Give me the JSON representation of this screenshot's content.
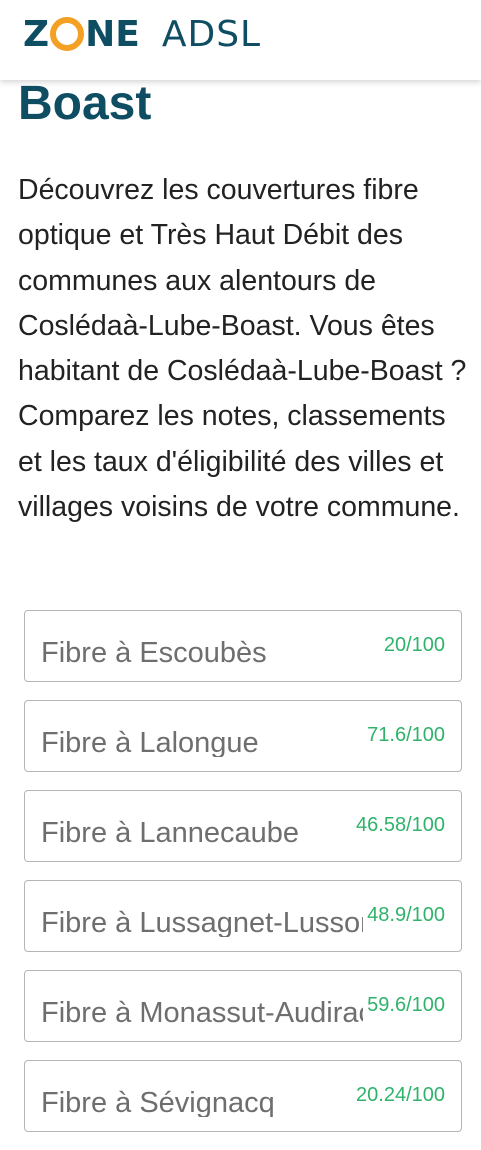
{
  "header": {
    "logo_zone_left": "Z",
    "logo_zone_right": "NE",
    "logo_adsl": "ADSL"
  },
  "colors": {
    "brand_dark": "#0f4d63",
    "brand_orange": "#f3a024",
    "score_green": "#2fb36b"
  },
  "page": {
    "title": "Boast",
    "intro": "Découvrez les couvertures fibre optique et Très Haut Débit des communes aux alentours de Coslédaà-Lube-Boast. Vous êtes habitant de Coslédaà-Lube-Boast ? Comparez les notes, classements et les taux d'éligibilité des villes et villages voisins de votre commune."
  },
  "communes": [
    {
      "label": "Fibre à Escoubès",
      "score": "20/100"
    },
    {
      "label": "Fibre à Lalongue",
      "score": "71.6/100"
    },
    {
      "label": "Fibre à Lannecaube",
      "score": "46.58/100"
    },
    {
      "label": "Fibre à Lussagnet-Lusson",
      "score": "48.9/100"
    },
    {
      "label": "Fibre à Monassut-Audiracq",
      "score": "59.6/100"
    },
    {
      "label": "Fibre à Sévignacq",
      "score": "20.24/100"
    }
  ]
}
